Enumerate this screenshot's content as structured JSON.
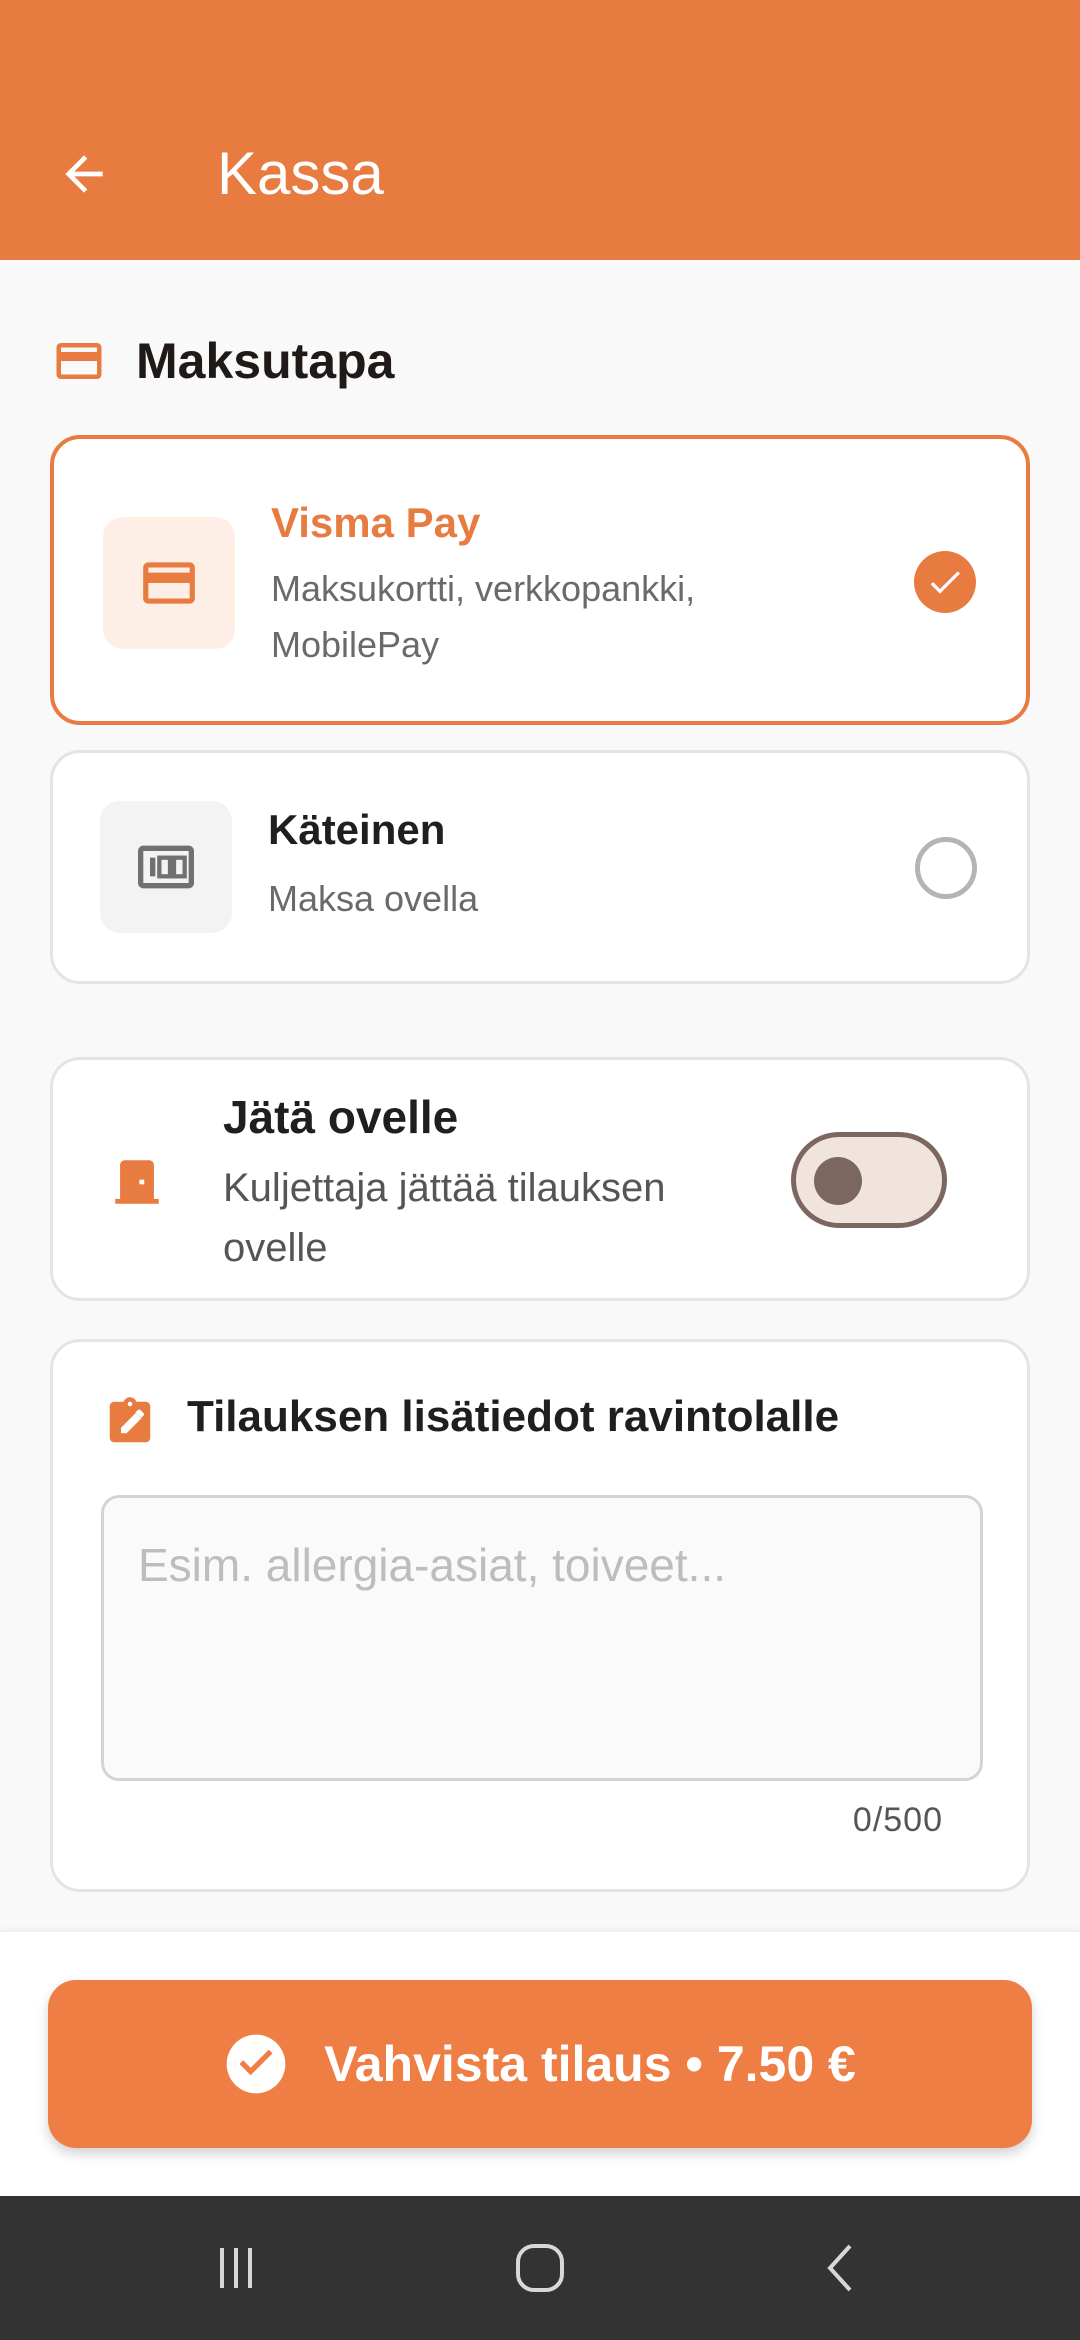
{
  "appbar": {
    "title": "Kassa"
  },
  "payment": {
    "section_title": "Maksutapa",
    "options": [
      {
        "title": "Visma Pay",
        "subtitle_line1": "Maksukortti, verkkopankki,",
        "subtitle_line2": "MobilePay",
        "selected": true
      },
      {
        "title": "Käteinen",
        "subtitle": "Maksa ovella",
        "selected": false
      }
    ]
  },
  "leave_at_door": {
    "title": "Jätä ovelle",
    "subtitle_line1": "Kuljettaja jättää tilauksen",
    "subtitle_line2": "ovelle",
    "enabled": false
  },
  "notes": {
    "title": "Tilauksen lisätiedot ravintolalle",
    "placeholder": "Esim. allergia-asiat, toiveet...",
    "value": "",
    "counter": "0/500"
  },
  "confirm": {
    "label": "Vahvista tilaus • 7.50 €"
  },
  "colors": {
    "accent": "#e77b40",
    "button": "#ee7e44",
    "nav_bar": "#333333"
  }
}
